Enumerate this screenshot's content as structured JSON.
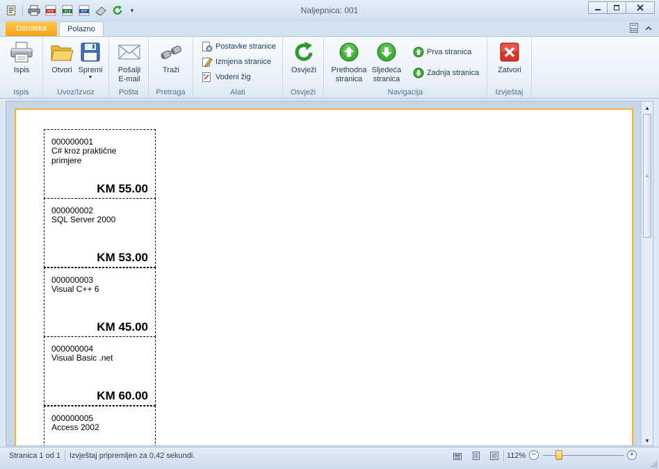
{
  "window": {
    "title": "Naljepnica: 001"
  },
  "qat": {
    "icons": [
      "document-icon",
      "printer-icon",
      "pdf-icon",
      "xls-icon",
      "rtf-icon",
      "eraser-icon",
      "refresh-icon"
    ]
  },
  "tabs": {
    "file": "Datoteka",
    "home": "Polazno"
  },
  "ribbon": {
    "groups": {
      "print": {
        "label": "Ispis",
        "buttons": {
          "print": "Ispis"
        }
      },
      "io": {
        "label": "Uvoz/Izvoz",
        "buttons": {
          "open": "Otvori",
          "save": "Spremi"
        }
      },
      "mail": {
        "label": "Pošta",
        "buttons": {
          "send_line1": "Pošalji",
          "send_line2": "E-mail"
        }
      },
      "search": {
        "label": "Pretraga",
        "buttons": {
          "search": "Traži"
        }
      },
      "tools": {
        "label": "Alati",
        "buttons": {
          "page_setup": "Postavke stranice",
          "page_edit": "Izmjena stranice",
          "watermark": "Vodeni žig"
        }
      },
      "refresh": {
        "label": "Osvježi",
        "buttons": {
          "refresh": "Osvježi"
        }
      },
      "navigation": {
        "label": "Navigacija",
        "buttons": {
          "prev_line1": "Prethodna",
          "prev_line2": "stranica",
          "next_line1": "Sljedeća",
          "next_line2": "stranica",
          "first": "Prva stranica",
          "last": "Zadnja stranica"
        }
      },
      "report": {
        "label": "Izvještaj",
        "buttons": {
          "close": "Zatvori"
        }
      }
    }
  },
  "labels": [
    {
      "code": "000000001",
      "name": "C# kroz praktične primjere",
      "price": "KM 55.00"
    },
    {
      "code": "000000002",
      "name": "SQL Server 2000",
      "price": "KM 53.00"
    },
    {
      "code": "000000003",
      "name": "Visual C++ 6",
      "price": "KM 45.00"
    },
    {
      "code": "000000004",
      "name": "Visual Basic .net",
      "price": "KM 60.00"
    },
    {
      "code": "000000005",
      "name": "Access 2002",
      "price": ""
    }
  ],
  "status": {
    "page": "Stranica 1 od 1",
    "message": "Izvještaj pripremljen za 0,42 sekundi.",
    "zoom": "112%",
    "zoom_level_percent": 112
  },
  "colors": {
    "file_tab": "#f4a21c",
    "page_border": "#f5b331",
    "close_red": "#d9342b",
    "nav_green": "#3a9b2e"
  }
}
